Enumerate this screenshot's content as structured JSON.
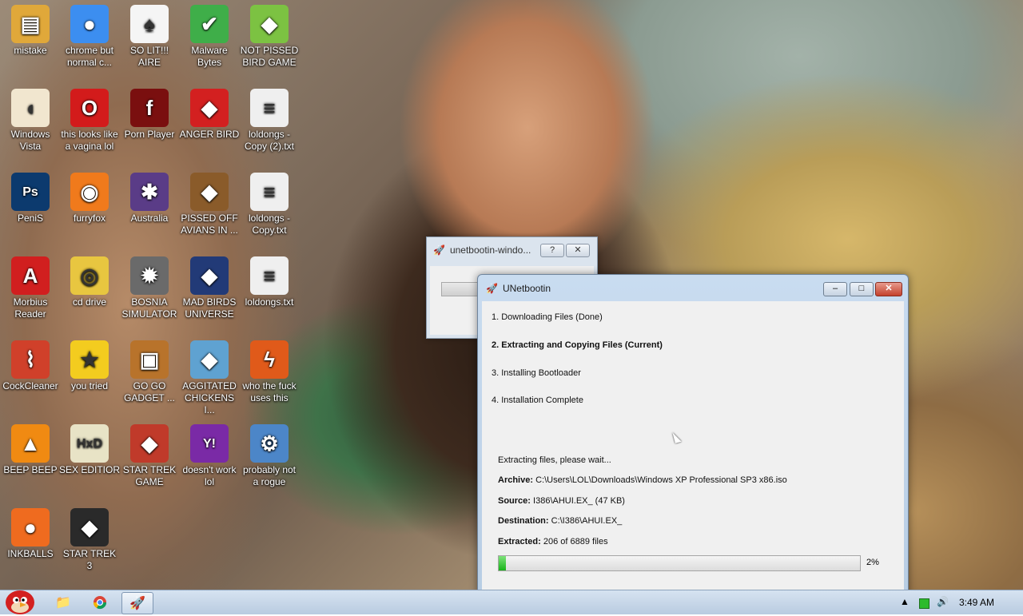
{
  "desktop": {
    "icons": [
      {
        "label": "mistake",
        "icon": "computer-folder-icon",
        "color": "#e0a83a"
      },
      {
        "label": "chrome but normal c...",
        "icon": "chrome-icon",
        "color": "#3c8ef0"
      },
      {
        "label": "SO LIT!!! AIRE",
        "icon": "playing-card-icon",
        "color": "#f5f5f5"
      },
      {
        "label": "Malware Bytes",
        "icon": "shield-icon",
        "color": "#3fae49"
      },
      {
        "label": "NOT PISSED BIRD GAME",
        "icon": "green-pig-icon",
        "color": "#7cc242"
      },
      {
        "label": "Windows Vista",
        "icon": "egg-icon",
        "color": "#f1e6cf"
      },
      {
        "label": "this looks like a vagina lol",
        "icon": "opera-icon",
        "color": "#d31b1b"
      },
      {
        "label": "Porn Player",
        "icon": "flash-icon",
        "color": "#7a0f0f"
      },
      {
        "label": "ANGER BIRD",
        "icon": "red-bird-icon",
        "color": "#d32020"
      },
      {
        "label": "loldongs - Copy (2).txt",
        "icon": "text-file-icon",
        "color": "#efefef"
      },
      {
        "label": "PeniS",
        "icon": "photoshop-icon",
        "color": "#0c3a6e"
      },
      {
        "label": "furryfox",
        "icon": "firefox-icon",
        "color": "#f07a1c"
      },
      {
        "label": "Australia",
        "icon": "spider-icon",
        "color": "#5a3c87"
      },
      {
        "label": "PISSED OFF AVIANS IN ...",
        "icon": "seasons-bird-icon",
        "color": "#8a5b2a"
      },
      {
        "label": "loldongs - Copy.txt",
        "icon": "text-file-icon",
        "color": "#efefef"
      },
      {
        "label": "Morbius Reader",
        "icon": "pdf-reader-icon",
        "color": "#d11f1f"
      },
      {
        "label": "cd drive",
        "icon": "cd-icon",
        "color": "#e8c640"
      },
      {
        "label": "BOSNIA SIMULATOR",
        "icon": "mine-icon",
        "color": "#6a6a6a"
      },
      {
        "label": "MAD BIRDS UNIVERSE",
        "icon": "space-bird-icon",
        "color": "#223a77"
      },
      {
        "label": "loldongs.txt",
        "icon": "text-file-icon",
        "color": "#efefef"
      },
      {
        "label": "CockCleaner",
        "icon": "broom-icon",
        "color": "#d0402a"
      },
      {
        "label": "you tried",
        "icon": "star-icon",
        "color": "#f3cc1f"
      },
      {
        "label": "GO GO GADGET ...",
        "icon": "briefcase-icon",
        "color": "#b8732b"
      },
      {
        "label": "AGGITATED CHICKENS I...",
        "icon": "rio-bird-icon",
        "color": "#5fa2d1"
      },
      {
        "label": "who the fuck uses this",
        "icon": "bolt-icon",
        "color": "#e05a1a"
      },
      {
        "label": "BEEP BEEP",
        "icon": "vlc-cone-icon",
        "color": "#f08a12"
      },
      {
        "label": "SEX EDITIOR",
        "icon": "hxd-icon",
        "color": "#e8e3c6"
      },
      {
        "label": "STAR TREK GAME",
        "icon": "star-wars-bird-icon",
        "color": "#c03a2a"
      },
      {
        "label": "doesn't work lol",
        "icon": "yahoo-messenger-icon",
        "color": "#7a2aa6"
      },
      {
        "label": "probably not a rogue",
        "icon": "settings-monitor-icon",
        "color": "#4c86c8"
      },
      {
        "label": "INKBALLS",
        "icon": "inkball-icon",
        "color": "#ef6b1f"
      },
      {
        "label": "STAR TREK 3",
        "icon": "star-wars-vader-icon",
        "color": "#2a2a2a"
      }
    ]
  },
  "background_window": {
    "title": "unetbootin-windo...",
    "help_label": "?",
    "close_label": "✕"
  },
  "main_window": {
    "title": "UNetbootin",
    "minimize_label": "–",
    "maximize_label": "□",
    "close_label": "✕",
    "steps": [
      {
        "text": "1. Downloading Files (Done)",
        "bold": false
      },
      {
        "text": "2. Extracting and Copying Files (Current)",
        "bold": true
      },
      {
        "text": "3. Installing Bootloader",
        "bold": false
      },
      {
        "text": "4. Installation Complete",
        "bold": false
      }
    ],
    "status": "Extracting files, please wait...",
    "archive_label": "Archive:",
    "archive_value": "C:\\Users\\LOL\\Downloads\\Windows XP Professional SP3 x86.iso",
    "source_label": "Source:",
    "source_value": "I386\\AHUI.EX_ (47 KB)",
    "destination_label": "Destination:",
    "destination_value": "C:\\I386\\AHUI.EX_",
    "extracted_label": "Extracted:",
    "extracted_value": "206 of 6889 files",
    "progress_percent": 2,
    "progress_text": "2%"
  },
  "taskbar": {
    "clock": "3:49 AM",
    "items": [
      {
        "name": "explorer",
        "icon": "folder-icon"
      },
      {
        "name": "chrome",
        "icon": "chrome-icon"
      },
      {
        "name": "unetbootin",
        "icon": "rocket-icon",
        "active": true
      }
    ]
  }
}
